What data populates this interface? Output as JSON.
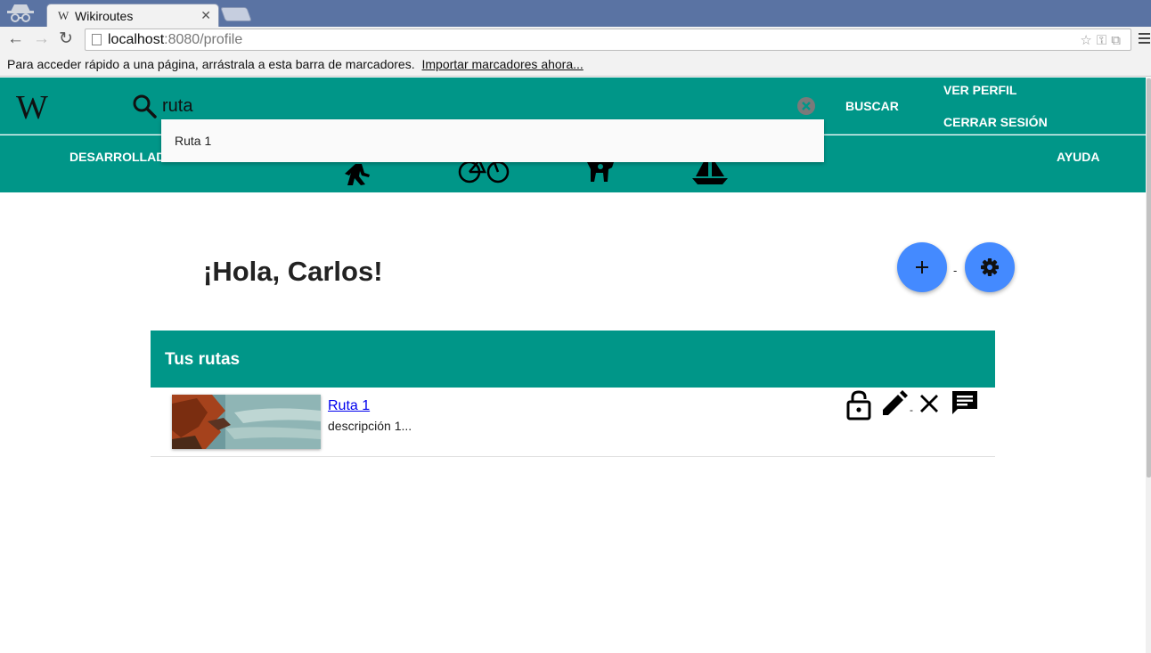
{
  "browser": {
    "tab_title": "Wikiroutes",
    "tab_favicon": "W",
    "url_host": "localhost",
    "url_rest": ":8080/profile",
    "bookmarks_text": "Para acceder rápido a una página, arrástrala a esta barra de marcadores.",
    "bookmarks_link": "Importar marcadores ahora..."
  },
  "header": {
    "logo": "W",
    "search_value": "ruta",
    "search_button": "BUSCAR",
    "ver_perfil": "VER PERFIL",
    "cerrar_sesion": "CERRAR SESIÓN"
  },
  "nav": {
    "left_link": "DESARROLLADORES",
    "right_link": "AYUDA",
    "categories": [
      "walking-icon",
      "bicycle-icon",
      "horse-icon",
      "sailboat-icon"
    ]
  },
  "autocomplete": {
    "items": [
      "Ruta 1"
    ]
  },
  "main": {
    "greeting": "¡Hola, Carlos!",
    "fab_separator": "-",
    "routes_title": "Tus rutas",
    "routes": [
      {
        "name": "Ruta 1",
        "description": "descripción 1...",
        "separator": "-"
      }
    ]
  },
  "colors": {
    "primary": "#009688",
    "accent": "#448aff",
    "link": "#0000ee"
  }
}
